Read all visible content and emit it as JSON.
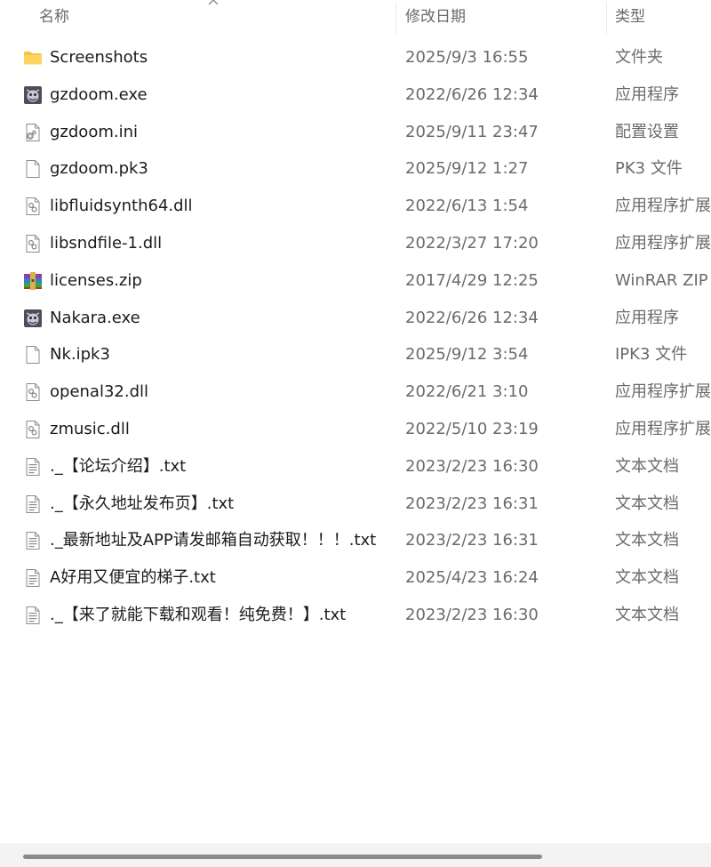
{
  "columns": {
    "name": "名称",
    "date": "修改日期",
    "type": "类型"
  },
  "files": [
    {
      "name": "Screenshots",
      "date": "2025/9/3 16:55",
      "type": "文件夹",
      "icon": "folder-icon"
    },
    {
      "name": "gzdoom.exe",
      "date": "2022/6/26 12:34",
      "type": "应用程序",
      "icon": "doom-app-icon"
    },
    {
      "name": "gzdoom.ini",
      "date": "2025/9/11 23:47",
      "type": "配置设置",
      "icon": "config-file-icon"
    },
    {
      "name": "gzdoom.pk3",
      "date": "2025/9/12 1:27",
      "type": "PK3 文件",
      "icon": "blank-file-icon"
    },
    {
      "name": "libfluidsynth64.dll",
      "date": "2022/6/13 1:54",
      "type": "应用程序扩展",
      "icon": "dll-file-icon"
    },
    {
      "name": "libsndfile-1.dll",
      "date": "2022/3/27 17:20",
      "type": "应用程序扩展",
      "icon": "dll-file-icon"
    },
    {
      "name": "licenses.zip",
      "date": "2017/4/29 12:25",
      "type": "WinRAR ZIP 压",
      "icon": "winrar-archive-icon"
    },
    {
      "name": "Nakara.exe",
      "date": "2022/6/26 12:34",
      "type": "应用程序",
      "icon": "doom-app-icon"
    },
    {
      "name": "Nk.ipk3",
      "date": "2025/9/12 3:54",
      "type": "IPK3 文件",
      "icon": "blank-file-icon"
    },
    {
      "name": "openal32.dll",
      "date": "2022/6/21 3:10",
      "type": "应用程序扩展",
      "icon": "dll-file-icon"
    },
    {
      "name": "zmusic.dll",
      "date": "2022/5/10 23:19",
      "type": "应用程序扩展",
      "icon": "dll-file-icon"
    },
    {
      "name": "._【论坛介绍】.txt",
      "date": "2023/2/23 16:30",
      "type": "文本文档",
      "icon": "text-file-icon"
    },
    {
      "name": "._【永久地址发布页】.txt",
      "date": "2023/2/23 16:31",
      "type": "文本文档",
      "icon": "text-file-icon"
    },
    {
      "name": "._最新地址及APP请发邮箱自动获取！！！.txt",
      "date": "2023/2/23 16:31",
      "type": "文本文档",
      "icon": "text-file-icon"
    },
    {
      "name": "A好用又便宜的梯子.txt",
      "date": "2025/4/23 16:24",
      "type": "文本文档",
      "icon": "text-file-icon"
    },
    {
      "name": "._【来了就能下载和观看！纯免费！】.txt",
      "date": "2023/2/23 16:30",
      "type": "文本文档",
      "icon": "text-file-icon"
    }
  ],
  "colors": {
    "folder": "#f7c24a",
    "header_text": "#6a6a6a",
    "meta_text": "#6b6b6b",
    "scroll_thumb": "#8a8a8a"
  }
}
